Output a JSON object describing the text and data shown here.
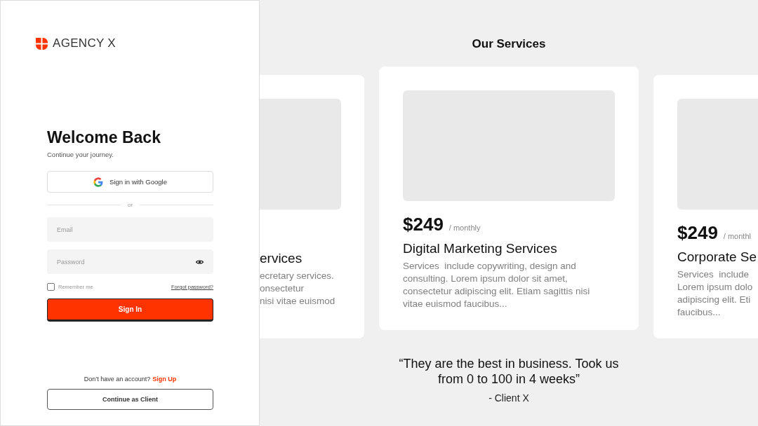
{
  "brand": {
    "name": "AGENCY X"
  },
  "login": {
    "title": "Welcome Back",
    "subtitle": "Continue your journey.",
    "google_button": "Sign in with Google",
    "divider": "or",
    "email": {
      "placeholder": "Email"
    },
    "password": {
      "placeholder": "Password"
    },
    "remember": {
      "label": "Remember me",
      "checked": false
    },
    "forgot": "Forgot password?",
    "sign_in": "Sign In",
    "signup_prompt": "Don’t have an account?",
    "signup_link": "Sign Up",
    "client_button": "Continue as Client"
  },
  "services": {
    "title": "Our Services",
    "cards": [
      {
        "name": "ervices",
        "lines": [
          "ecretary services.",
          "onsectetur",
          "nisi vitae euismod"
        ]
      },
      {
        "price": "$249",
        "period": "/ monthly",
        "name": "Digital Marketing Services",
        "lines": [
          "Services  include copywriting, design and",
          "consulting. Lorem ipsum dolor sit amet,",
          "consectetur adipiscing elit. Etiam sagittis nisi",
          "vitae euismod faucibus..."
        ]
      },
      {
        "price": "$249",
        "period": "/ monthl",
        "name": "Corporate Se",
        "lines": [
          "Services  include",
          "Lorem ipsum dolo",
          "adipiscing elit. Eti",
          "faucibus..."
        ]
      }
    ]
  },
  "testimonial": {
    "quote": "“They are the best in business. Took us from 0 to 100 in 4 weeks”",
    "author": "- Client X"
  }
}
